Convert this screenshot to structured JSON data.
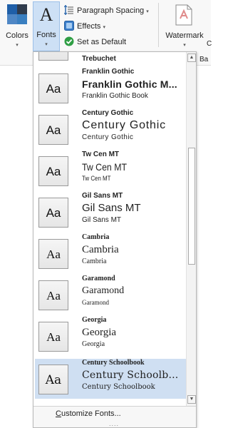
{
  "ribbon": {
    "colors_label": "Colors",
    "fonts_glyph": "A",
    "fonts_label": "Fonts",
    "paragraph_spacing_label": "Paragraph Spacing",
    "effects_label": "Effects",
    "set_default_label": "Set as Default",
    "watermark_label": "Watermark",
    "edge_text_top": "C",
    "edge_text_bottom": "Ba",
    "caret": "▾"
  },
  "fonts_gallery": {
    "partial_top_item": {
      "name": "Trebuchet"
    },
    "items": [
      {
        "name": "Franklin Gothic",
        "heading": "Franklin Gothic M...",
        "body": "Franklin Gothic Book",
        "sample": "Aa"
      },
      {
        "name": "Century Gothic",
        "heading": "Century Gothic",
        "body": "Century Gothic",
        "sample": "Aa"
      },
      {
        "name": "Tw Cen MT",
        "heading": "Tw Cen MT",
        "body": "Tw Cen MT",
        "sample": "Aa"
      },
      {
        "name": "Gil Sans MT",
        "heading": "Gil Sans MT",
        "body": "Gil Sans MT",
        "sample": "Aa"
      },
      {
        "name": "Cambria",
        "heading": "Cambria",
        "body": "Cambria",
        "sample": "Aa"
      },
      {
        "name": "Garamond",
        "heading": "Garamond",
        "body": "Garamond",
        "sample": "Aa"
      },
      {
        "name": "Georgia",
        "heading": "Georgia",
        "body": "Georgia",
        "sample": "Aa"
      },
      {
        "name": "Century Schoolbook",
        "heading": "Century Schoolb...",
        "body": "Century Schoolbook",
        "sample": "Aa",
        "selected": true
      }
    ],
    "customize_label": "Customize Fonts...",
    "resize_grip": "....",
    "scroll_up": "▲",
    "scroll_down": "▼"
  },
  "colors": {
    "selected_bg": "#cfdff2",
    "fonts_button_bg": "#cde0f5",
    "accent_blue": "#1f5fa8"
  }
}
